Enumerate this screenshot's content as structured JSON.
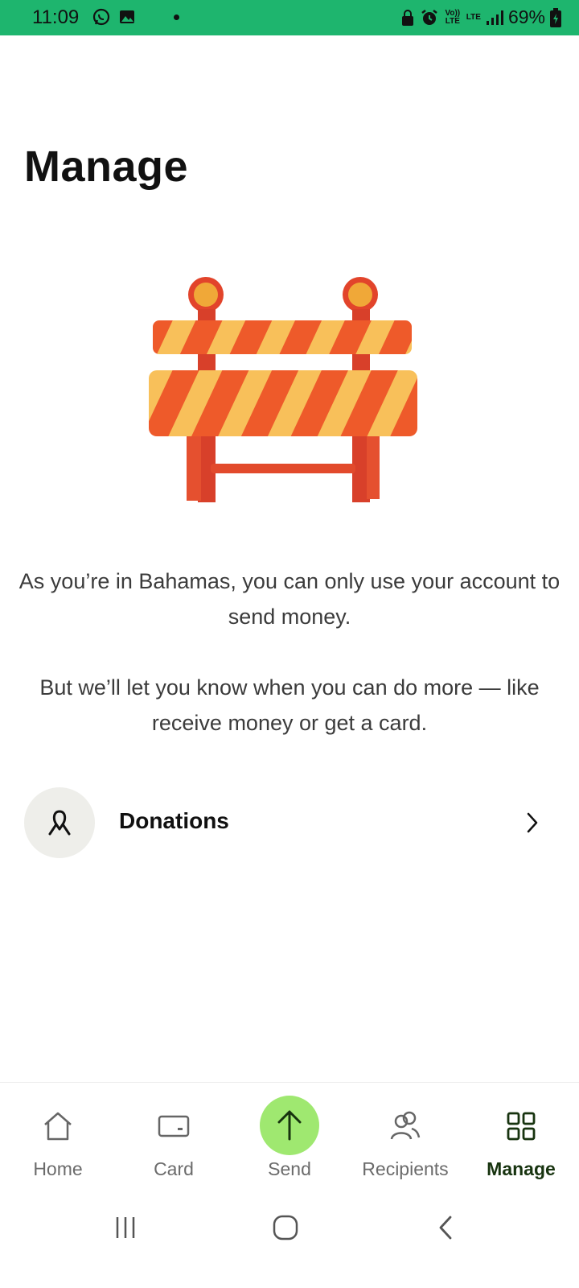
{
  "status_bar": {
    "time": "11:09",
    "battery": "69%",
    "network": "LTE",
    "volte": "Vo)) LTE",
    "bg_color": "#1eb56e"
  },
  "page": {
    "title": "Manage"
  },
  "info": {
    "line1": "As you’re in Bahamas, you can only use your account to send money.",
    "line2": "But we’ll let you know when you can do more — like receive money or get a card."
  },
  "donations": {
    "label": "Donations",
    "icon": "ribbon-icon"
  },
  "bottom_nav": {
    "items": [
      {
        "label": "Home",
        "icon": "home-icon"
      },
      {
        "label": "Card",
        "icon": "card-icon"
      },
      {
        "label": "Send",
        "icon": "arrow-up-icon"
      },
      {
        "label": "Recipients",
        "icon": "recipients-icon"
      },
      {
        "label": "Manage",
        "icon": "grid-icon",
        "active": true
      }
    ],
    "accent": "#9fe870",
    "active_color": "#17330f"
  }
}
